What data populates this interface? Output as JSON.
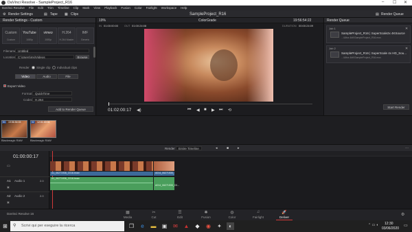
{
  "window": {
    "title": "DaVinci Resolve - SampleProject_R16"
  },
  "menu": [
    "DaVinci Resolve",
    "File",
    "Edit",
    "Trim",
    "Timeline",
    "Clip",
    "Mark",
    "View",
    "Playback",
    "Fusion",
    "Color",
    "Fairlight",
    "Workspace",
    "Help"
  ],
  "toolbar": {
    "render_settings": "Render Settings",
    "tape": "Tape",
    "clips": "Clips",
    "project_name": "SampleProject_R16",
    "render_queue": "Render Queue"
  },
  "render_settings": {
    "title": "Render Settings - Custom",
    "formats": [
      {
        "logo": "Custom",
        "label": "Custom"
      },
      {
        "logo": "YouTube",
        "label": "1080p"
      },
      {
        "logo": "vimeo",
        "label": "1080p"
      },
      {
        "logo": "H.264",
        "label": "H.264 Master"
      },
      {
        "logo": "IMF",
        "label": "Generic"
      }
    ],
    "filename_label": "Filename",
    "filename_value": "Untitled",
    "location_label": "Location",
    "location_value": "C:\\Users\\ms\\Videos",
    "browse": "Browse",
    "render_label": "Render",
    "single_clip": "Single clip",
    "individual_clips": "Individual clips",
    "tabs": [
      "Video",
      "Audio",
      "File"
    ],
    "export_video": "Export Video",
    "format_label": "Format",
    "format_value": "QuickTime",
    "codec_label": "Codec",
    "codec_value": "H.264",
    "add_to_queue": "Add to Render Queue"
  },
  "viewer": {
    "zoom": "19%",
    "in_label": "IN",
    "in_tc": "01:00:00:00",
    "out_label": "OUT",
    "out_tc": "01:00:24:08",
    "timeline_name": "ColorGrade",
    "duration_label": "DURATION",
    "duration_tc": "00:00:24:09",
    "top_tc": "19:56:54:22",
    "timecode": "01:02:00:17"
  },
  "render_queue": {
    "title": "Render Queue",
    "jobs": [
      {
        "id": "Job 1",
        "name": "SampleProject_R16 | SuperScale2x 4KSource",
        "path": "...\\Ultra 4kK\\SampleProject_R16.mov"
      },
      {
        "id": "Job 2",
        "name": "SampleProject_R16 | SuperScale 4x HD_Sou...",
        "path": "...\\Ultra 4kK\\SampleProject_R16.mov"
      }
    ],
    "start_render": "Start Render"
  },
  "clips": [
    {
      "tc": "19:56:54:03",
      "name": "Blackmagic RAW",
      "num": "01"
    },
    {
      "tc": "12:01:40:04",
      "name": "Blackmagic RAW",
      "num": "02"
    }
  ],
  "timeline_bar": {
    "render": "Render",
    "scope": "Entire Timeline"
  },
  "timeline": {
    "timecode": "01:00:00:17",
    "tracks": [
      {
        "id": "A1",
        "name": "Audio 1",
        "level": "2.0"
      },
      {
        "id": "A2",
        "name": "Audio 2",
        "level": "2.0"
      }
    ],
    "clip_a": "A1_06271936_C016.braw",
    "clip_b": "A014_06271535_C0..."
  },
  "pages": {
    "app": "DaVinci Resolve 16",
    "items": [
      "Media",
      "Cut",
      "Edit",
      "Fusion",
      "Color",
      "Fairlight",
      "Deliver"
    ],
    "active": "Deliver"
  },
  "taskbar": {
    "search_placeholder": "Scrivi qui per eseguire la ricerca",
    "time": "12:30",
    "date": "03/06/2020"
  },
  "colors": {
    "accent_red": "#c8323a",
    "audio_green": "#4a9e5c",
    "deliver_underline": "#d33a3a"
  }
}
